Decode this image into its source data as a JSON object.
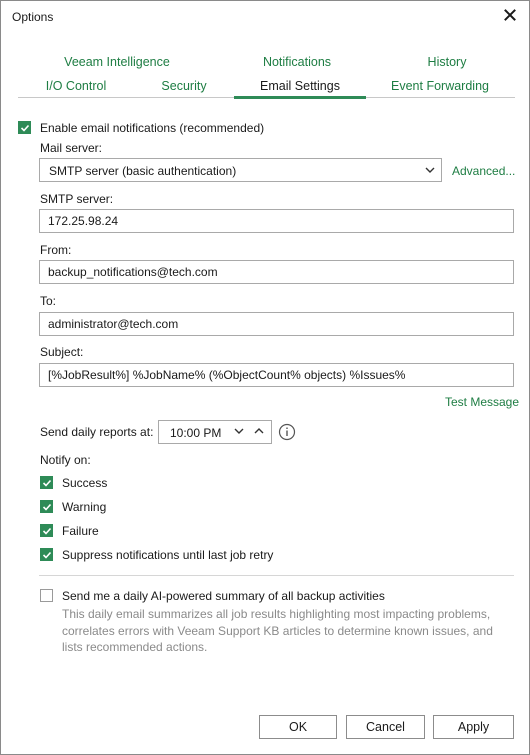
{
  "window": {
    "title": "Options"
  },
  "tabs_row1": [
    {
      "label": "Veeam Intelligence"
    },
    {
      "label": "Notifications"
    },
    {
      "label": "History"
    }
  ],
  "tabs_row2": [
    {
      "label": "I/O Control"
    },
    {
      "label": "Security"
    },
    {
      "label": "Email Settings",
      "active": true
    },
    {
      "label": "Event Forwarding"
    }
  ],
  "email": {
    "enable_label": "Enable email notifications (recommended)",
    "enable_checked": true,
    "mail_server_label": "Mail server:",
    "mail_server_value": "SMTP server (basic authentication)",
    "advanced_link": "Advanced...",
    "smtp_label": "SMTP server:",
    "smtp_value": "172.25.98.24",
    "from_label": "From:",
    "from_value": "backup_notifications@tech.com",
    "to_label": "To:",
    "to_value": "administrator@tech.com",
    "subject_label": "Subject:",
    "subject_value": "[%JobResult%] %JobName% (%ObjectCount% objects) %Issues%",
    "test_message_link": "Test Message",
    "daily_reports_label": "Send daily reports at:",
    "daily_reports_time": "10:00 PM",
    "notify_on_label": "Notify on:",
    "notify_options": [
      {
        "label": "Success",
        "checked": true
      },
      {
        "label": "Warning",
        "checked": true
      },
      {
        "label": "Failure",
        "checked": true
      },
      {
        "label": "Suppress notifications until last job retry",
        "checked": true
      }
    ],
    "ai_summary_label": "Send me a daily AI-powered summary of all backup activities",
    "ai_summary_checked": false,
    "ai_summary_description": "This daily email summarizes all job results highlighting most impacting problems, correlates errors with Veeam Support KB articles to determine known issues, and lists recommended actions."
  },
  "buttons": {
    "ok": "OK",
    "cancel": "Cancel",
    "apply": "Apply"
  },
  "colors": {
    "accent": "#2e8b57",
    "link": "#1e7d43",
    "muted_text": "#8a8a8a"
  }
}
